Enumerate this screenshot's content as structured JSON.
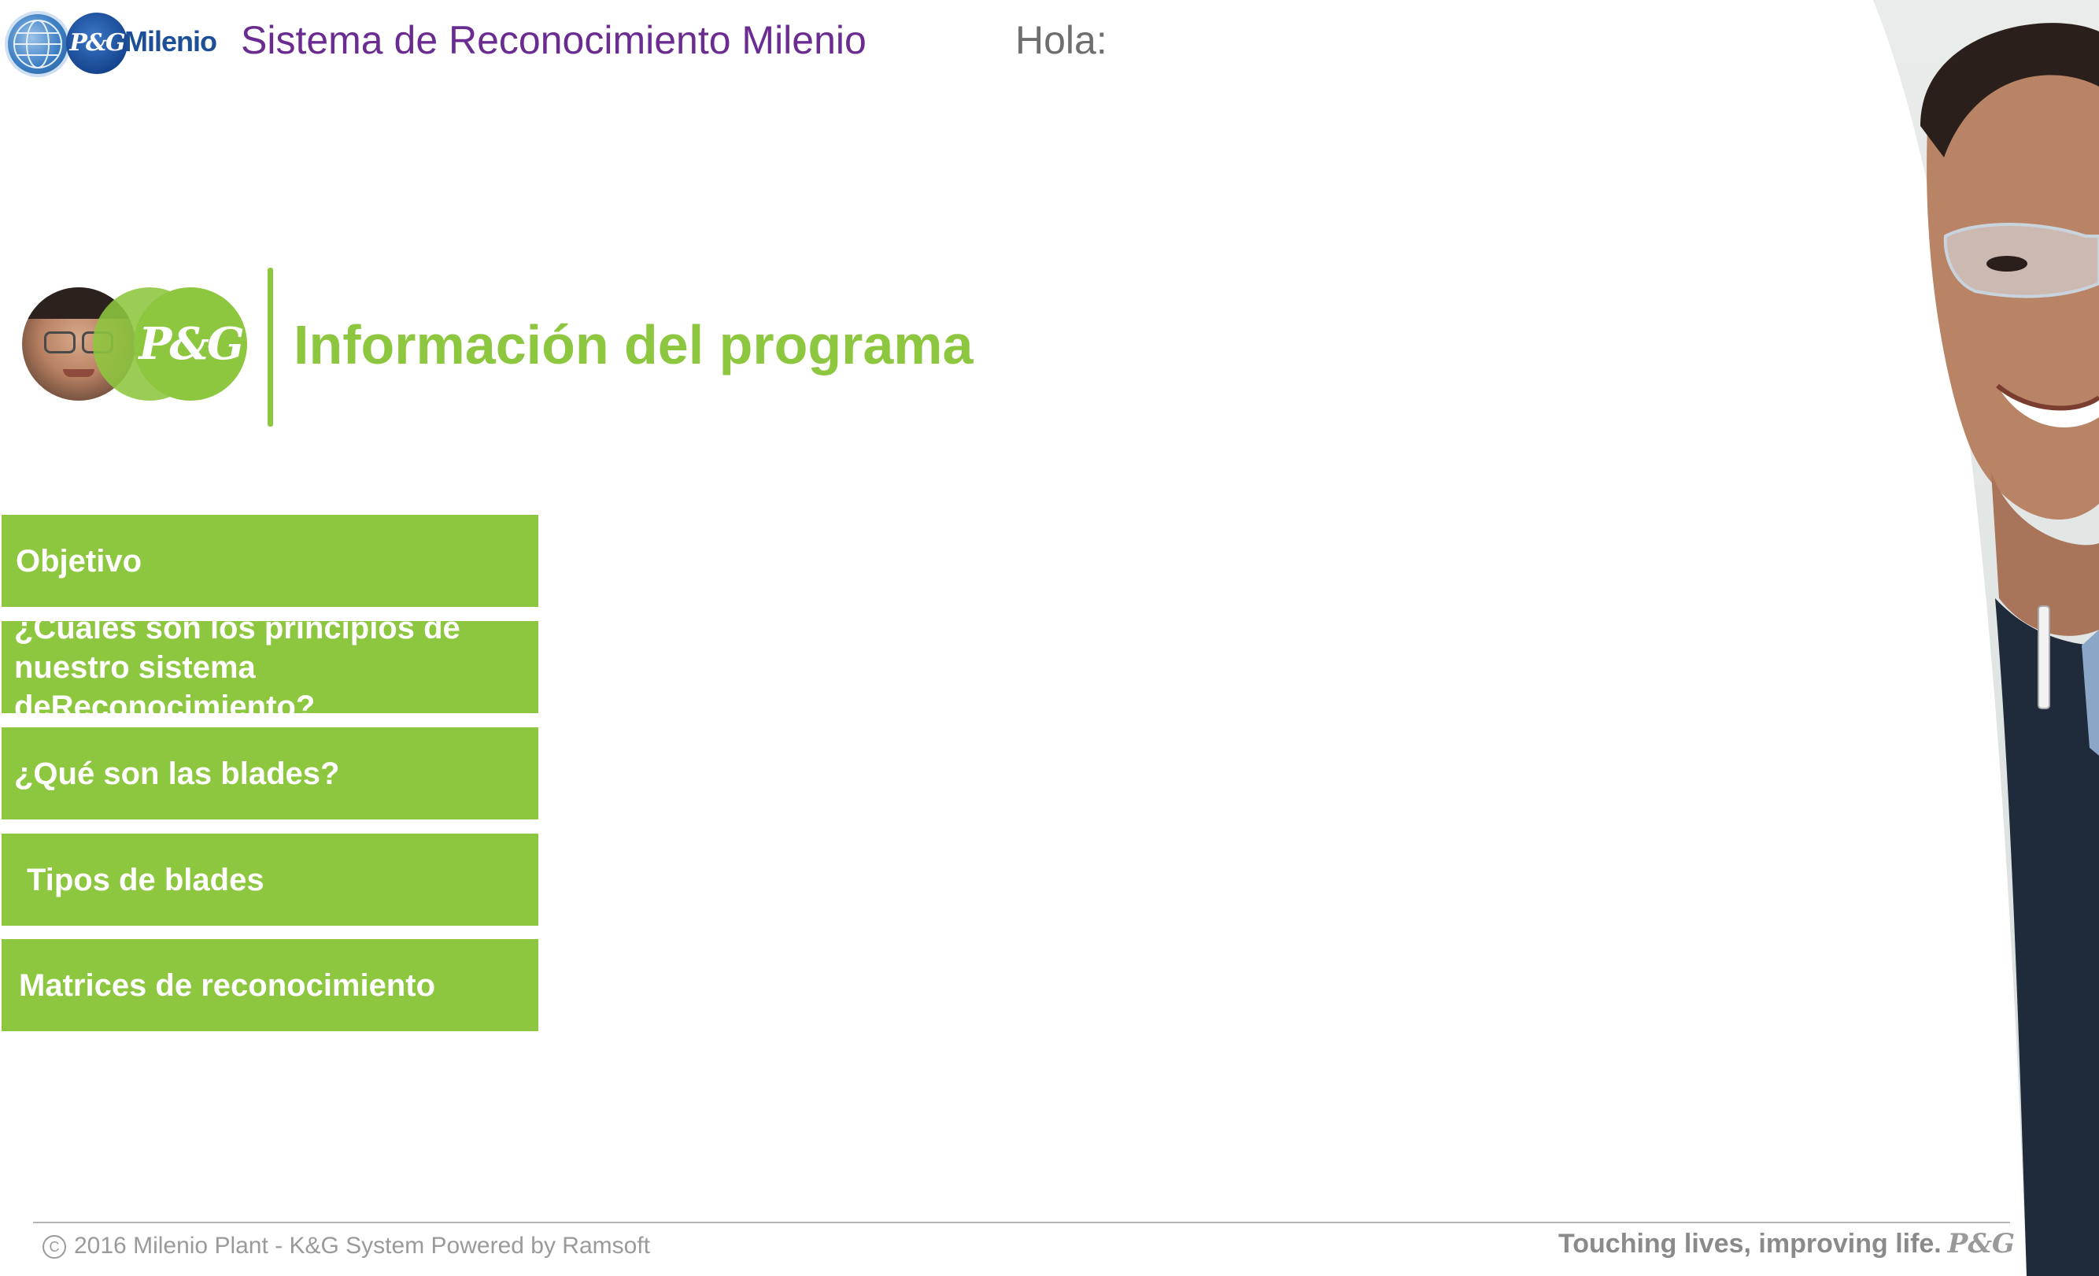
{
  "header": {
    "logo_text": "P&G Milenio",
    "logo_pg": "P&G",
    "logo_word": "Milenio",
    "app_title": "Sistema de Reconocimiento Milenio",
    "greeting": "Hola:"
  },
  "section": {
    "badge_text": "P&G",
    "title": "Información del programa"
  },
  "menu": {
    "items": [
      {
        "label": "Objetivo"
      },
      {
        "label": "¿Cuáles son los principios de\nnuestro sistema deReconocimiento?"
      },
      {
        "label": "¿Qué son las blades?"
      },
      {
        "label": "Tipos de blades"
      },
      {
        "label": "Matrices de reconocimiento"
      }
    ]
  },
  "footer": {
    "copyright_symbol": "C",
    "copyright": "2016 Milenio Plant - K&G System Powered by Ramsoft",
    "tagline": "Touching lives, improving life.",
    "brand": "P&G"
  },
  "colors": {
    "accent_green": "#8dc63f",
    "title_purple": "#6a2c91",
    "logo_blue": "#1d4f97"
  }
}
